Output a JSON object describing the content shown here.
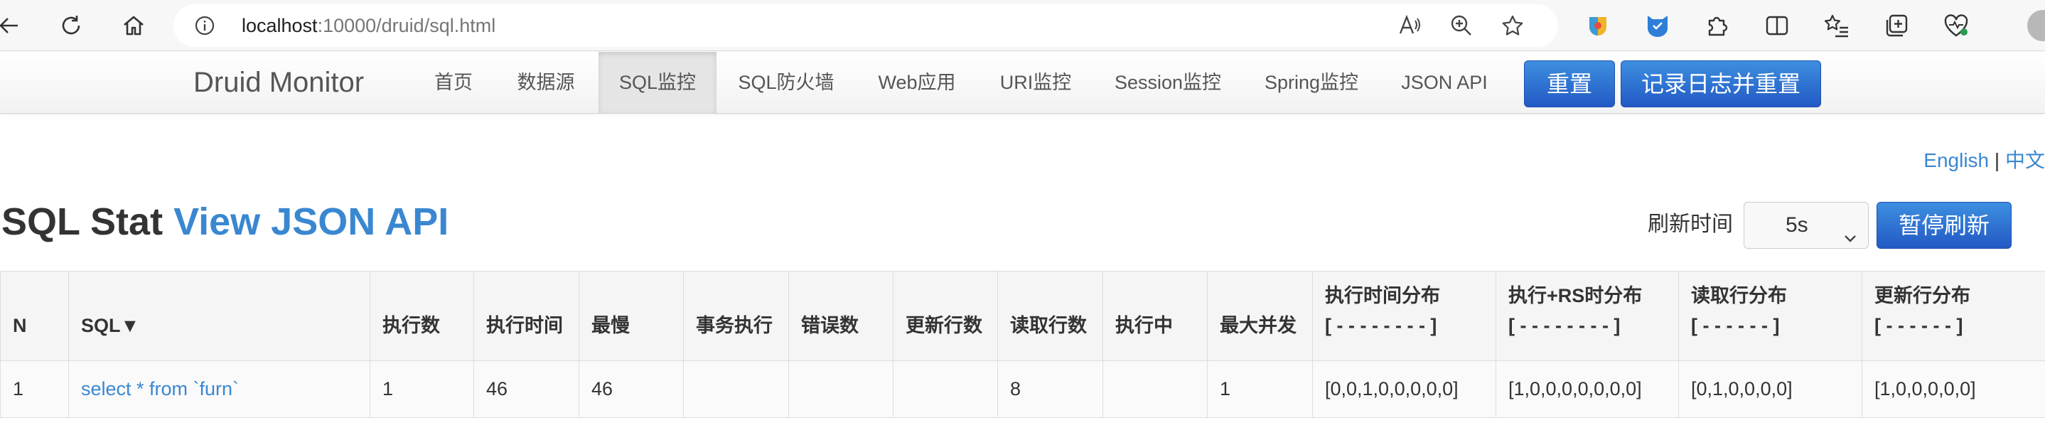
{
  "browser": {
    "url_host": "localhost",
    "url_rest": ":10000/druid/sql.html"
  },
  "navbar": {
    "brand": "Druid Monitor",
    "items": [
      {
        "label": "首页"
      },
      {
        "label": "数据源"
      },
      {
        "label": "SQL监控"
      },
      {
        "label": "SQL防火墙"
      },
      {
        "label": "Web应用"
      },
      {
        "label": "URI监控"
      },
      {
        "label": "Session监控"
      },
      {
        "label": "Spring监控"
      },
      {
        "label": "JSON API"
      }
    ],
    "active_item": "SQL监控",
    "reset_label": "重置",
    "log_reset_label": "记录日志并重置"
  },
  "lang": {
    "english": "English",
    "separator": "|",
    "chinese": "中文"
  },
  "page": {
    "title": "SQL Stat",
    "api_link": "View JSON API",
    "refresh_label": "刷新时间",
    "refresh_value": "5s",
    "pause_label": "暂停刷新"
  },
  "table": {
    "headers": [
      "N",
      "SQL▼",
      "执行数",
      "执行时间",
      "最慢",
      "事务执行",
      "错误数",
      "更新行数",
      "读取行数",
      "执行中",
      "最大并发",
      "执行时间分布",
      "执行+RS时分布",
      "读取行分布",
      "更新行分布"
    ],
    "header_sublines": {
      "exec_time_dist": "[ - - - - - - - - ]",
      "exec_rs_dist": "[ - - - - - - - - ]",
      "read_row_dist": "[ - - - - - - ]",
      "update_row_dist": "[ - - - - - - ]"
    },
    "rows": [
      {
        "n": "1",
        "sql": "select * from `furn`",
        "exec_count": "1",
        "exec_time": "46",
        "slowest": "46",
        "txn_exec": "",
        "error_count": "",
        "update_rows": "",
        "read_rows": "8",
        "running": "",
        "max_concurrent": "1",
        "exec_time_dist": "[0,0,1,0,0,0,0,0]",
        "exec_rs_dist": "[1,0,0,0,0,0,0,0]",
        "read_row_dist": "[0,1,0,0,0,0]",
        "update_row_dist": "[1,0,0,0,0,0]"
      }
    ]
  },
  "colors": {
    "link": "#3a87d1",
    "primary_button": "#2a6fd6",
    "navbar_bg": "#f5f5f5",
    "table_header_bg": "#f5f5f5"
  }
}
